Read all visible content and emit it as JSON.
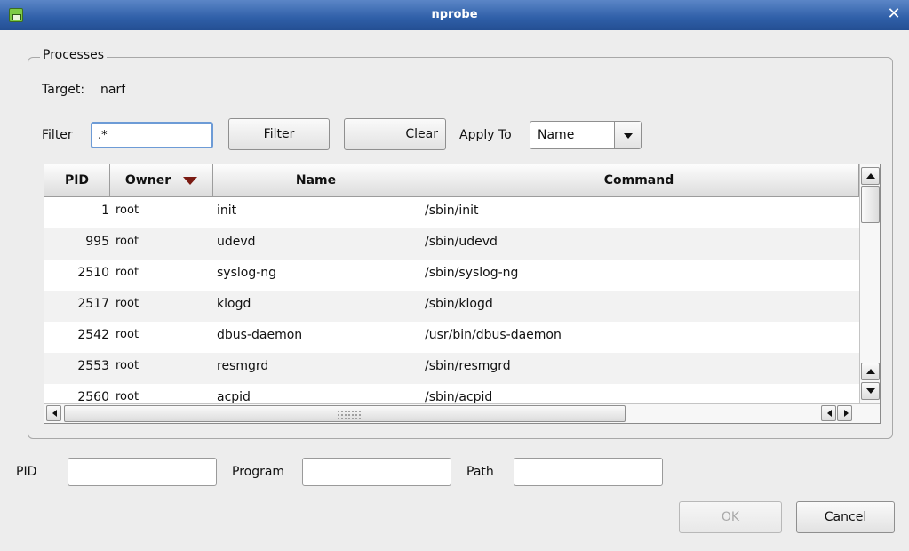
{
  "window": {
    "title": "nprobe",
    "close_glyph": "✕",
    "icon": "app-icon"
  },
  "processes": {
    "group_title": "Processes",
    "target_label": "Target:",
    "target_value": "narf",
    "filter_label": "Filter",
    "filter_value": ".*",
    "filter_button": "Filter",
    "clear_button": "Clear",
    "apply_to_label": "Apply To",
    "apply_to_value": "Name"
  },
  "table": {
    "columns": [
      "PID",
      "Owner",
      "Name",
      "Command"
    ],
    "sorted_column": "Owner",
    "sort_direction": "descending",
    "rows": [
      {
        "pid": "1",
        "owner": "root",
        "name": "init",
        "command": "/sbin/init"
      },
      {
        "pid": "995",
        "owner": "root",
        "name": "udevd",
        "command": "/sbin/udevd"
      },
      {
        "pid": "2510",
        "owner": "root",
        "name": "syslog-ng",
        "command": "/sbin/syslog-ng"
      },
      {
        "pid": "2517",
        "owner": "root",
        "name": "klogd",
        "command": "/sbin/klogd"
      },
      {
        "pid": "2542",
        "owner": "root",
        "name": "dbus-daemon",
        "command": "/usr/bin/dbus-daemon"
      },
      {
        "pid": "2553",
        "owner": "root",
        "name": "resmgrd",
        "command": "/sbin/resmgrd"
      },
      {
        "pid": "2560",
        "owner": "root",
        "name": "acpid",
        "command": "/sbin/acpid"
      }
    ]
  },
  "bottom": {
    "pid_label": "PID",
    "pid_value": "",
    "program_label": "Program",
    "program_value": "",
    "path_label": "Path",
    "path_value": "",
    "ok_button": "OK",
    "cancel_button": "Cancel"
  },
  "colors": {
    "titlebar": "#2f5fa8",
    "sort_arrow": "#7a1a12",
    "focus_ring": "#6d9bd6"
  }
}
